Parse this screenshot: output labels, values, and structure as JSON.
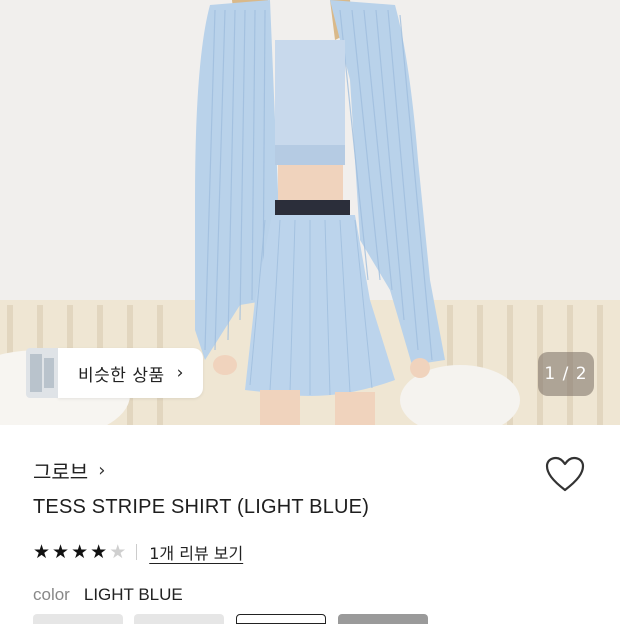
{
  "hero": {
    "similar_label": "비슷한 상품",
    "similar_arrow": "›",
    "page_indicator": "1 / 2"
  },
  "product": {
    "brand": "그로브",
    "brand_arrow": "›",
    "title": "TESS STRIPE SHIRT (LIGHT BLUE)",
    "rating": {
      "filled": 4,
      "total": 5
    },
    "review_link": "1개 리뷰 보기",
    "color_label": "color",
    "color_value": "LIGHT BLUE"
  },
  "icons": {
    "wish": "heart-outline-icon",
    "star": "star-icon"
  },
  "colors": {
    "shirt": "#b9d2ea",
    "text": "#222222",
    "star_on": "#111111",
    "star_off": "#cfcfcf"
  }
}
